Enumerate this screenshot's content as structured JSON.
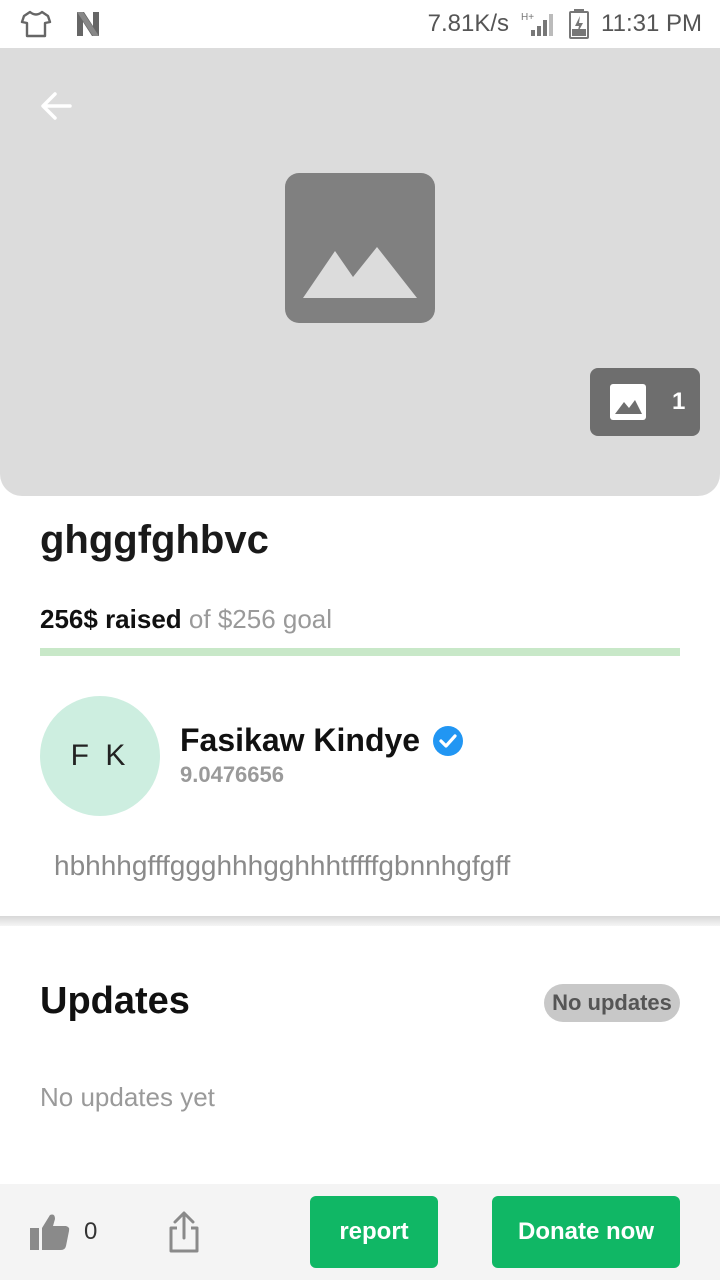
{
  "status_bar": {
    "net_speed": "7.81K/s",
    "network": "H+",
    "time": "11:31 PM",
    "icons": [
      "tshirt-icon",
      "n-logo-icon",
      "signal-icon",
      "battery-charging-icon"
    ]
  },
  "hero": {
    "back_icon": "arrow-left-icon",
    "placeholder_icon": "image-placeholder-icon",
    "image_count": "1"
  },
  "campaign": {
    "title": "ghggfghbvc",
    "raised_label": "256$ raised",
    "goal_label": "of $256 goal",
    "progress": 1.0,
    "progress_color": "#c8e8c8"
  },
  "organizer": {
    "initials": "F K",
    "name": "Fasikaw Kindye",
    "subtitle": "9.0476656",
    "verified": true,
    "verified_color": "#2196f3",
    "avatar_color": "#cdeee0"
  },
  "description": "hbhhhgfffggghhhgghhhtffffgbnnhgfgff",
  "updates": {
    "title": "Updates",
    "badge": "No updates",
    "empty_text": "No updates yet"
  },
  "bottom_bar": {
    "like_count": "0",
    "report_label": "report",
    "donate_label": "Donate now",
    "accent": "#10b765"
  }
}
